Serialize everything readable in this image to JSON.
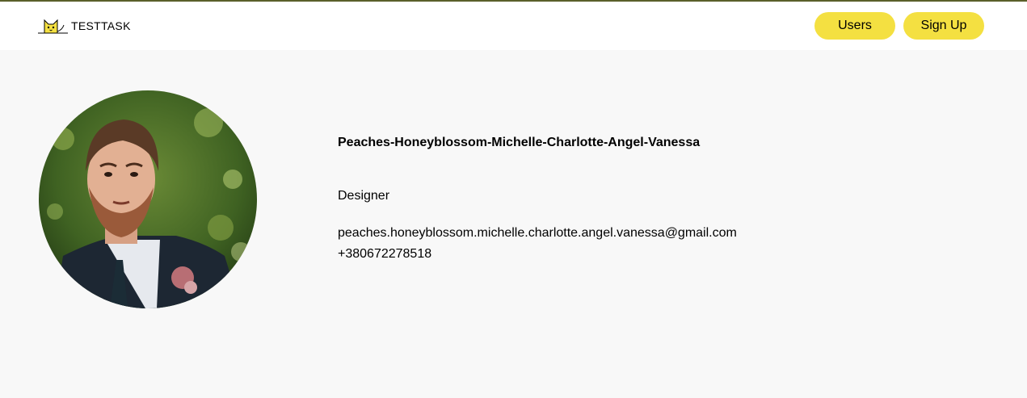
{
  "header": {
    "logo_text": "TESTTASK",
    "nav": [
      {
        "label": "Users"
      },
      {
        "label": "Sign Up"
      }
    ],
    "logo_icon": "cat-logo-icon"
  },
  "profile": {
    "name": "Peaches-Honeyblossom-Michelle-Charlotte-Angel-Vanessa",
    "position": "Designer",
    "email": "peaches.honeyblossom.michelle.charlotte.angel.vanessa@gmail.com",
    "phone": "+380672278518",
    "photo": "user-photo"
  },
  "colors": {
    "accent": "#f4e041",
    "background": "#f8f8f8",
    "header_background": "#ffffff",
    "top_border": "#5a5f2a"
  }
}
